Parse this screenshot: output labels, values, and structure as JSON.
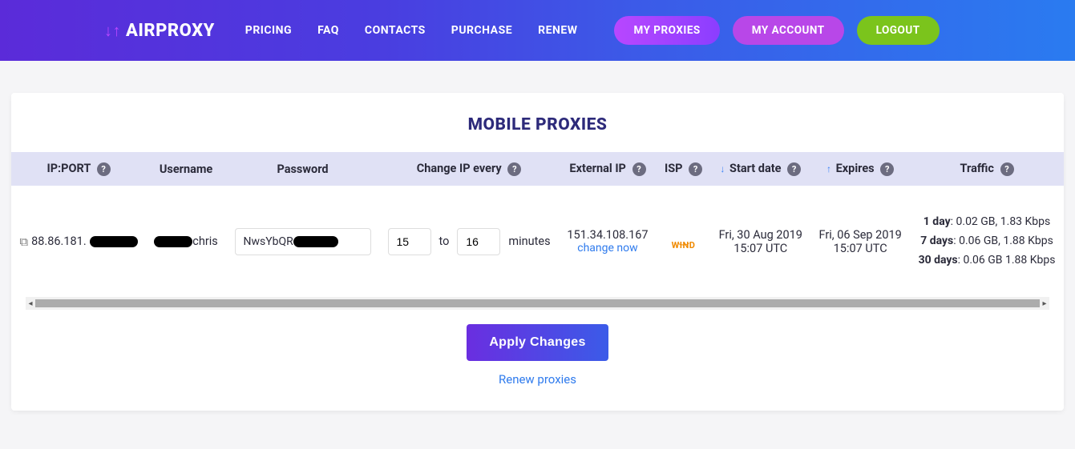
{
  "header": {
    "logo_text": "AIRPROXY",
    "nav": {
      "pricing": "PRICING",
      "faq": "FAQ",
      "contacts": "CONTACTS",
      "purchase": "PURCHASE",
      "renew": "RENEW"
    },
    "pills": {
      "my_proxies": "MY PROXIES",
      "my_account": "MY ACCOUNT",
      "logout": "LOGOUT"
    }
  },
  "main": {
    "title": "MOBILE PROXIES",
    "columns": {
      "ipport": "IP:PORT",
      "username": "Username",
      "password": "Password",
      "change_ip": "Change IP every",
      "external_ip": "External IP",
      "isp": "ISP",
      "start_date": "Start date",
      "expires": "Expires",
      "traffic": "Traffic"
    },
    "row": {
      "ip_prefix": "88.86.181.",
      "username_suffix": "chris",
      "password_prefix": "NwsYbQR",
      "change_from": "15",
      "change_sep": "to",
      "change_to": "16",
      "change_unit": "minutes",
      "external_ip": "151.34.108.167",
      "change_now": "change now",
      "isp": "WIND",
      "start_date_line1": "Fri, 30 Aug 2019",
      "start_date_line2": "15:07 UTC",
      "expires_line1": "Fri, 06 Sep 2019",
      "expires_line2": "15:07 UTC",
      "traffic": {
        "d1_label": "1 day",
        "d1_value": ": 0.02 GB, 1.83 Kbps",
        "d7_label": "7 days",
        "d7_value": ": 0.06 GB, 1.88 Kbps",
        "d30_label": "30 days",
        "d30_value": ": 0.06 GB 1.88 Kbps"
      }
    },
    "apply_btn": "Apply Changes",
    "renew_link": "Renew proxies",
    "help_char": "?"
  }
}
